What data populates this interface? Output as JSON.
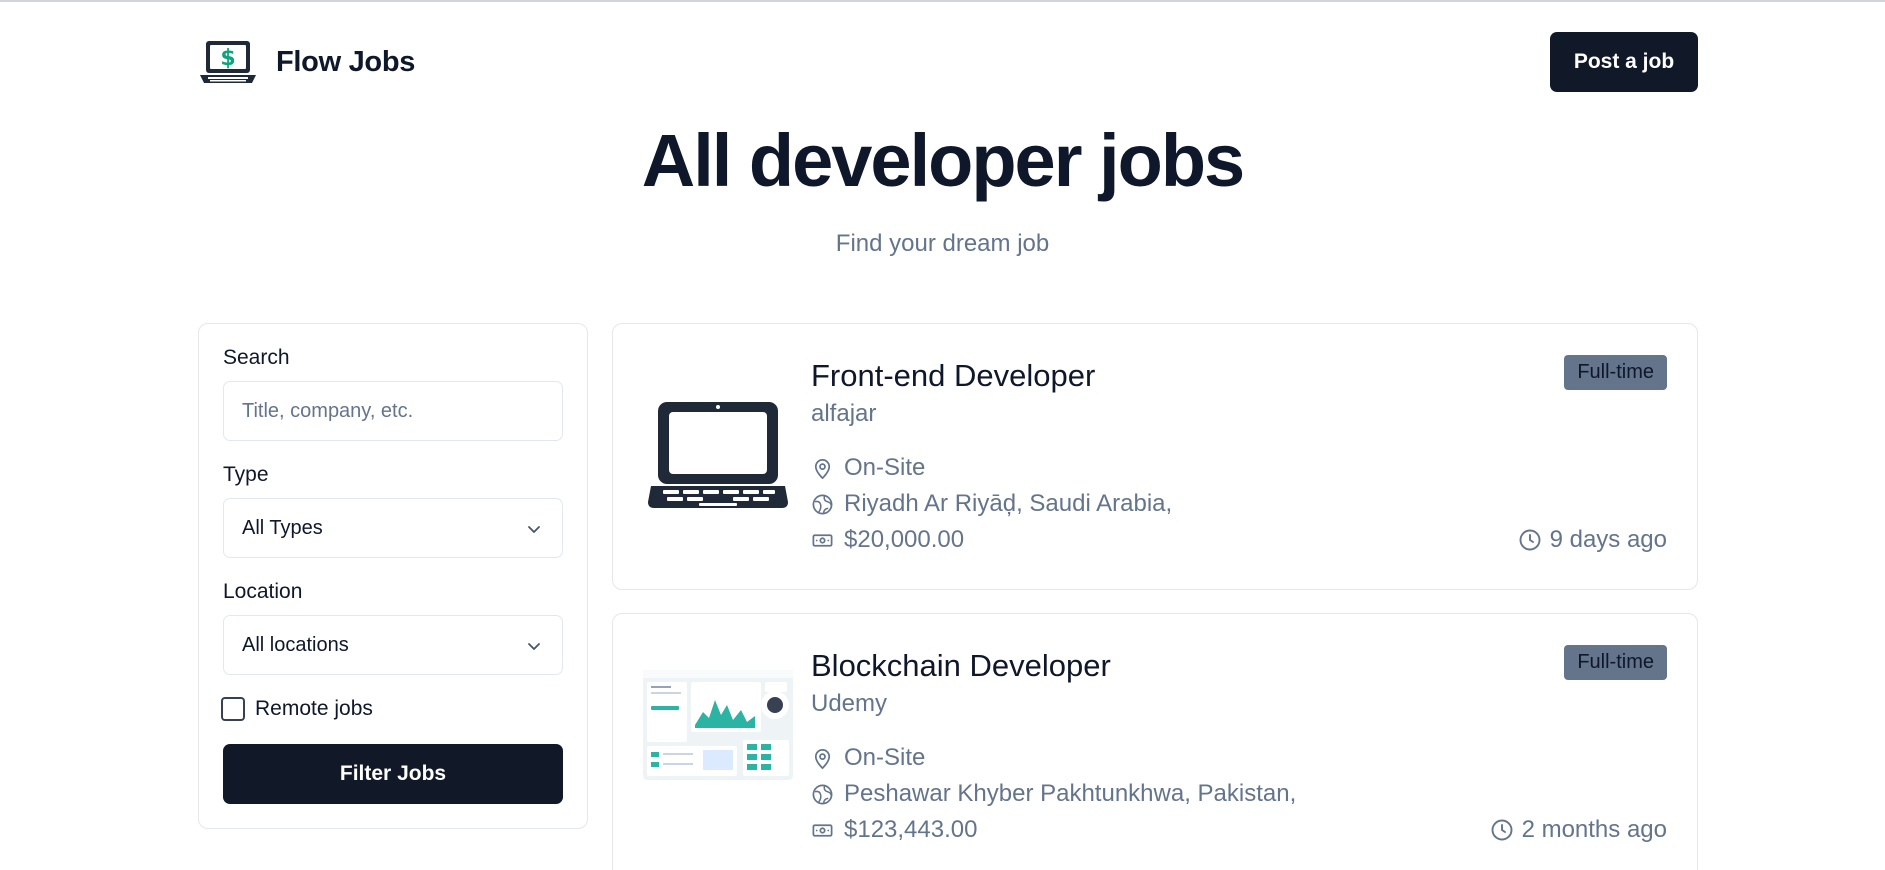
{
  "header": {
    "brand": "Flow Jobs",
    "post_label": "Post a job"
  },
  "hero": {
    "title": "All developer jobs",
    "subtitle": "Find your dream job"
  },
  "filters": {
    "search_label": "Search",
    "search_placeholder": "Title, company, etc.",
    "type_label": "Type",
    "type_value": "All Types",
    "location_label": "Location",
    "location_value": "All locations",
    "remote_label": "Remote jobs",
    "remote_checked": false,
    "filter_label": "Filter Jobs"
  },
  "jobs": [
    {
      "title": "Front-end Developer",
      "company": "alfajar",
      "type": "Full-time",
      "location_type": "On-Site",
      "location": "Riyadh Ar Riyāḑ, Saudi Arabia,",
      "salary": "$20,000.00",
      "posted": "9 days ago",
      "logo": "laptop-logo"
    },
    {
      "title": "Blockchain Developer",
      "company": "Udemy",
      "type": "Full-time",
      "location_type": "On-Site",
      "location": "Peshawar Khyber Pakhtunkhwa, Pakistan,",
      "salary": "$123,443.00",
      "posted": "2 months ago",
      "logo": "dashboard-screenshot-logo"
    }
  ],
  "colors": {
    "primary": "#111827",
    "muted": "#64748b",
    "border": "#e5e7eb",
    "logo_accent": "#10a37f"
  }
}
